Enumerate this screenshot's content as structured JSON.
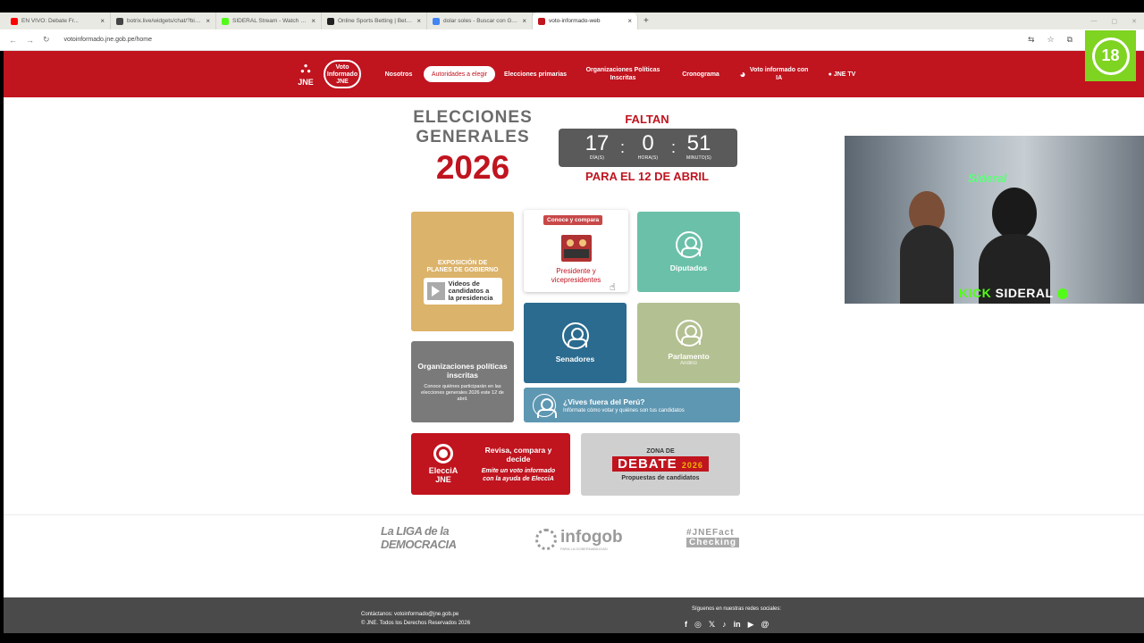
{
  "browser": {
    "tabs": [
      {
        "title": "EN VIVO: Debate Fr...",
        "color": "#ff0000"
      },
      {
        "title": "botrix.live/widgets/chat/?bid=...",
        "color": "#444444"
      },
      {
        "title": "SIDERAL Stream - Watch Live o...",
        "color": "#53fc18"
      },
      {
        "title": "Online Sports Betting | Betting...",
        "color": "#222222"
      },
      {
        "title": "dolar soles - Buscar con Google",
        "color": "#4285f4"
      },
      {
        "title": "voto-informado-web",
        "color": "#c0141f"
      }
    ],
    "new_tab": "+",
    "address": "votoinformado.jne.gob.pe/home"
  },
  "nav": {
    "logo_jne": "JNE",
    "logo_vi_line1": "Voto",
    "logo_vi_line2": "Informado",
    "logo_vi_line3": "JNE",
    "items": {
      "nosotros": "Nosotros",
      "autoridades": "Autoridades a elegir",
      "primarias": "Elecciones primarias",
      "organizaciones": "Organizaciones Políticas Inscritas",
      "cronograma": "Cronograma",
      "ia": "Voto informado con IA",
      "tv": "● JNE TV"
    }
  },
  "hero": {
    "elecciones_line1": "ELECCIONES",
    "elecciones_line2": "GENERALES",
    "year": "2026",
    "faltan": "FALTAN",
    "dias": "17",
    "dias_label": "DÍA(S)",
    "horas": "0",
    "horas_label": "HORA(S)",
    "minutos": "51",
    "minutos_label": "MINUTO(S)",
    "separator": ":",
    "fecha": "PARA EL 12 DE ABRIL"
  },
  "cards": {
    "exposicion_title_1": "EXPOSICIÓN DE",
    "exposicion_title_2": "PLANES DE GOBIERNO",
    "videos_1": "Videos de",
    "videos_2": "candidatos a",
    "videos_3": "la presidencia",
    "conoce_badge": "Conoce y compara",
    "presidente_1": "Presidente y",
    "presidente_2": "vicepresidentes",
    "diputados": "Diputados",
    "senadores": "Senadores",
    "parlamento": "Parlamento",
    "andino": "Andino",
    "org_title": "Organizaciones políticas inscritas",
    "org_desc": "Conoce quiénes participarán en las elecciones generales 2026 este 12 de abril.",
    "fuera_title": "¿Vives fuera del Perú?",
    "fuera_desc": "Infórmate cómo votar y quiénes son tus candidatos",
    "eleccia_1": "ElecciA",
    "eleccia_2": "JNE",
    "revisa_title": "Revisa, compara y decide",
    "revisa_desc": "Emite un voto informado con la ayuda de ElecciA",
    "zona": "ZONA DE",
    "debate": "DEBATE",
    "debate_year": "2026",
    "propuestas": "Propuestas de candidatos"
  },
  "partners": {
    "liga": "La LIGA de la DEMOCRACIA",
    "infogob": "infogob",
    "infogob_sub": "PARA LA GOBERNABILIDAD",
    "fact_1": "#JNEFact",
    "fact_2": "Checking"
  },
  "footer": {
    "contact": "Contáctanos: votoinformado@jne.gob.pe",
    "copyright": "© JNE. Todos los Derechos Reservados 2026",
    "social_label": "Síguenos en nuestras redes sociales:",
    "social": [
      "f",
      "◎",
      "𝕏",
      "♪",
      "in",
      "▶",
      "@"
    ]
  },
  "stream": {
    "neon": "Sideral",
    "kick": "KICK",
    "name": "SIDERAL"
  },
  "age_badge": "18"
}
